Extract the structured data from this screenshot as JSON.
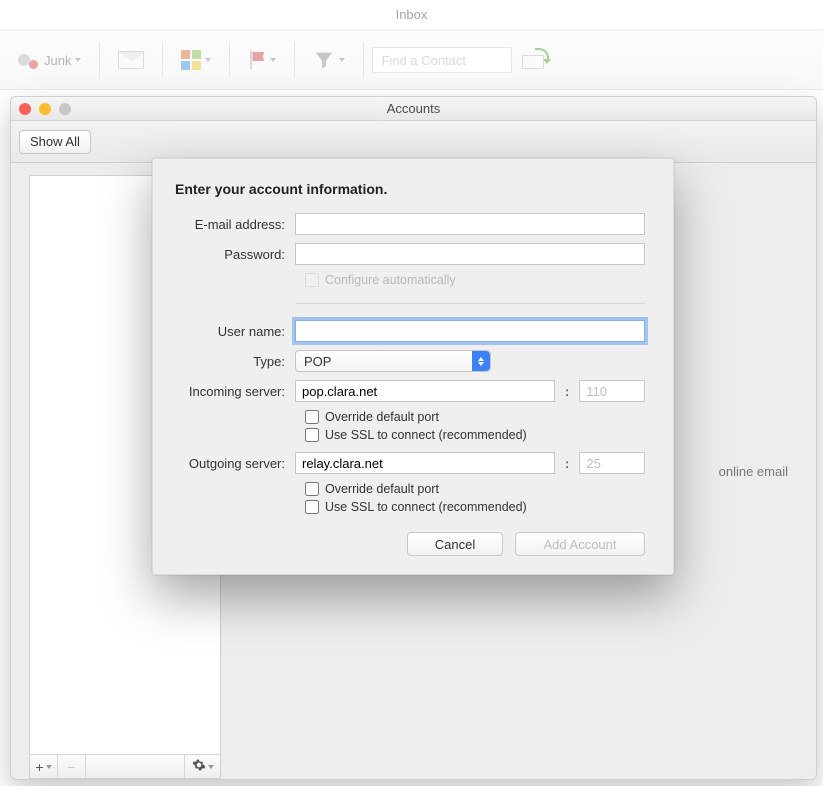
{
  "app": {
    "title": "Inbox"
  },
  "toolbar": {
    "junk_label": "Junk",
    "find_contact_placeholder": "Find a Contact"
  },
  "accounts_window": {
    "title": "Accounts",
    "show_all_label": "Show All",
    "hint_fragment": "online email"
  },
  "dialog": {
    "heading": "Enter your account information.",
    "email_label": "E-mail address:",
    "email_value": "",
    "password_label": "Password:",
    "password_value": "",
    "configure_auto_label": "Configure automatically",
    "configure_auto_checked": false,
    "username_label": "User name:",
    "username_value": "",
    "type_label": "Type:",
    "type_value": "POP",
    "incoming_label": "Incoming server:",
    "incoming_value": "pop.clara.net",
    "incoming_port": "110",
    "override_port_label": "Override default port",
    "use_ssl_label": "Use SSL to connect (recommended)",
    "outgoing_label": "Outgoing server:",
    "outgoing_value": "relay.clara.net",
    "outgoing_port": "25",
    "cancel_label": "Cancel",
    "add_account_label": "Add Account"
  }
}
